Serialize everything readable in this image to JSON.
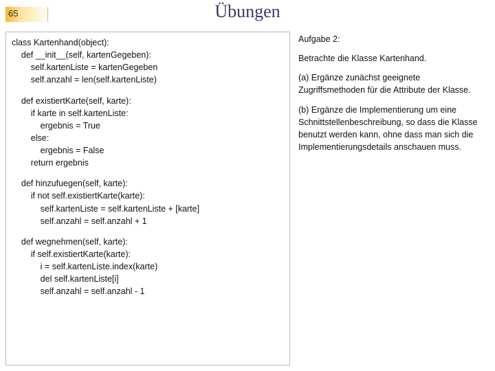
{
  "header": {
    "page_number": "65",
    "title": "Übungen"
  },
  "code": {
    "b1": {
      "l1": "class Kartenhand(object):",
      "l2": "    def __init__(self, kartenGegeben):",
      "l3": "        self.kartenListe = kartenGegeben",
      "l4": "        self.anzahl = len(self.kartenListe)"
    },
    "b2": {
      "l1": "    def existiertKarte(self, karte):",
      "l2": "        if karte in self.kartenListe:",
      "l3": "            ergebnis = True",
      "l4": "        else:",
      "l5": "            ergebnis = False",
      "l6": "        return ergebnis"
    },
    "b3": {
      "l1": "    def hinzufuegen(self, karte):",
      "l2": "        if not self.existiertKarte(karte):",
      "l3": "            self.kartenListe = self.kartenListe + [karte]",
      "l4": "            self.anzahl = self.anzahl + 1"
    },
    "b4": {
      "l1": "    def wegnehmen(self, karte):",
      "l2": "        if self.existiertKarte(karte):",
      "l3": "            i = self.kartenListe.index(karte)",
      "l4": "            del self.kartenListe[i]",
      "l5": "            self.anzahl = self.anzahl - 1"
    }
  },
  "task": {
    "heading": "Aufgabe 2:",
    "intro": "Betrachte die Klasse Kartenhand.",
    "a": "(a) Ergänze zunächst geeignete Zugriffsmethoden für die Attribute der Klasse.",
    "b": "(b) Ergänze die Implementierung um eine Schnittstellenbeschreibung, so dass die Klasse benutzt werden kann, ohne dass man sich die Implementierungsdetails anschauen muss."
  }
}
